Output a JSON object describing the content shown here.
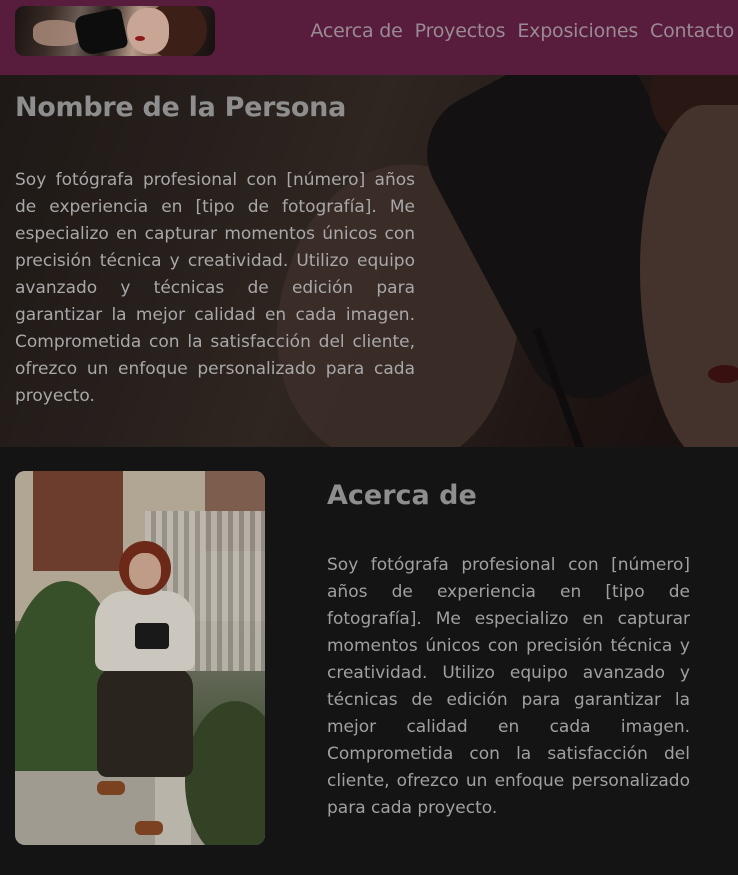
{
  "nav": {
    "logo_alt": "logo",
    "links": [
      "Acerca de",
      "Proyectos",
      "Exposiciones",
      "Contacto"
    ]
  },
  "hero": {
    "title": "Nombre de la Persona",
    "text": "Soy fotógrafa profesional con [número] años de experiencia en [tipo de fotografía]. Me especializo en capturar momentos únicos con precisión técnica y creatividad. Utilizo equipo avanzado y técnicas de edición para garantizar la mejor calidad en cada imagen. Comprometida con la satisfacción del cliente, ofrezco un enfoque personalizado para cada proyecto."
  },
  "about": {
    "title": "Acerca de",
    "text": "Soy fotógrafa profesional con [número] años de experiencia en [tipo de fotografía]. Me especializo en capturar momentos únicos con precisión técnica y creatividad. Utilizo equipo avanzado y técnicas de edición para garantizar la mejor calidad en cada imagen. Comprometida con la satisfacción del cliente, ofrezco un enfoque personalizado para cada proyecto."
  },
  "colors": {
    "nav_bg": "#581c3c",
    "page_bg": "#141414",
    "heading": "#8e8e8e",
    "body_text": "#a8a8a8"
  }
}
